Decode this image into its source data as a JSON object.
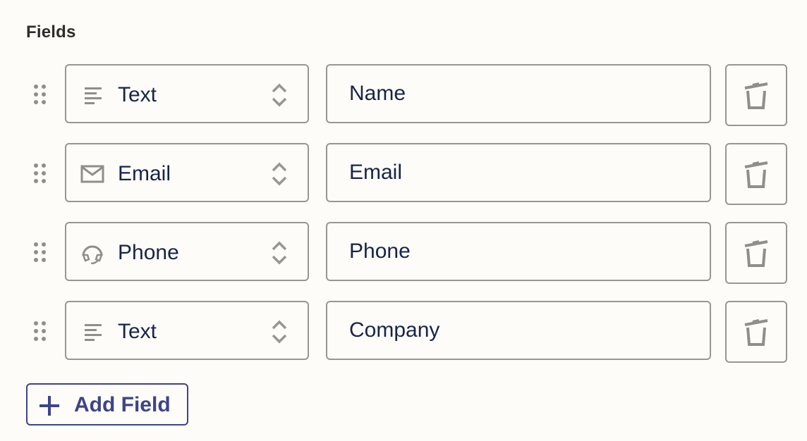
{
  "section": {
    "title": "Fields"
  },
  "fields": [
    {
      "type": "Text",
      "type_icon": "text-lines-icon",
      "name": "Name"
    },
    {
      "type": "Email",
      "type_icon": "envelope-icon",
      "name": "Email"
    },
    {
      "type": "Phone",
      "type_icon": "headset-icon",
      "name": "Phone"
    },
    {
      "type": "Text",
      "type_icon": "text-lines-icon",
      "name": "Company"
    }
  ],
  "actions": {
    "add_field_label": "Add Field"
  },
  "colors": {
    "background": "#fdfcf8",
    "border": "#979691",
    "text": "#17244a",
    "accent": "#3d4488",
    "icon": "#8f8e8a"
  }
}
